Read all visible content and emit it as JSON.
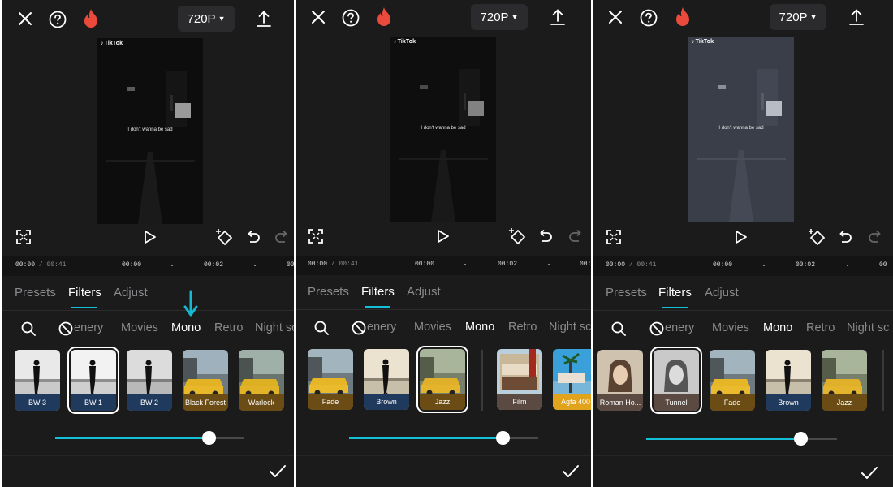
{
  "panels": [
    {
      "quality_label": "720P",
      "video": {
        "watermark": "TikTok",
        "caption": "I don't wanna be sad"
      },
      "timeline": {
        "current": "00:00",
        "total": "/ 00:41",
        "tick_1": "00:00",
        "tick_2": "00:02",
        "tick_3": "00"
      },
      "tabs": [
        "Presets",
        "Filters",
        "Adjust"
      ],
      "active_tab": "Filters",
      "categories": [
        "enery",
        "Movies",
        "Mono",
        "Retro",
        "Night sc"
      ],
      "active_category": "Mono",
      "filters": [
        {
          "name": "BW 3"
        },
        {
          "name": "BW 1",
          "selected": true
        },
        {
          "name": "BW 2"
        },
        {
          "name": "Black Forest"
        },
        {
          "name": "Warlock"
        }
      ],
      "intensity": 0.81
    },
    {
      "quality_label": "720P",
      "video": {
        "watermark": "TikTok",
        "caption": "I don't wanna be sad"
      },
      "timeline": {
        "current": "00:00",
        "total": "/ 00:41",
        "tick_1": "00:00",
        "tick_2": "00:02",
        "tick_3": "00:"
      },
      "tabs": [
        "Presets",
        "Filters",
        "Adjust"
      ],
      "active_tab": "Filters",
      "categories": [
        "enery",
        "Movies",
        "Mono",
        "Retro",
        "Night sc"
      ],
      "active_category": "Mono",
      "filters": [
        {
          "name": "Fade"
        },
        {
          "name": "Brown"
        },
        {
          "name": "Jazz",
          "selected": true
        },
        {
          "name": "Film"
        },
        {
          "name": "Agfa 400"
        }
      ],
      "intensity": 0.81
    },
    {
      "quality_label": "720P",
      "video": {
        "watermark": "TikTok",
        "caption": "I don't wanna be sad"
      },
      "timeline": {
        "current": "00:00",
        "total": "/ 00:41",
        "tick_1": "00:00",
        "tick_2": "00:02",
        "tick_3": "00"
      },
      "tabs": [
        "Presets",
        "Filters",
        "Adjust"
      ],
      "active_tab": "Filters",
      "categories": [
        "enery",
        "Movies",
        "Mono",
        "Retro",
        "Night sc"
      ],
      "active_category": "Mono",
      "filters": [
        {
          "name": "Roman Ho..."
        },
        {
          "name": "Tunnel",
          "selected": true
        },
        {
          "name": "Fade"
        },
        {
          "name": "Brown"
        },
        {
          "name": "Jazz"
        }
      ],
      "intensity": 0.81
    }
  ],
  "colors": {
    "background": "#1b1b1c",
    "accent": "#14c0d8",
    "label_blue": "#1f3a5c",
    "label_amber": "#6b4c14",
    "label_brown": "#5a4a42"
  }
}
